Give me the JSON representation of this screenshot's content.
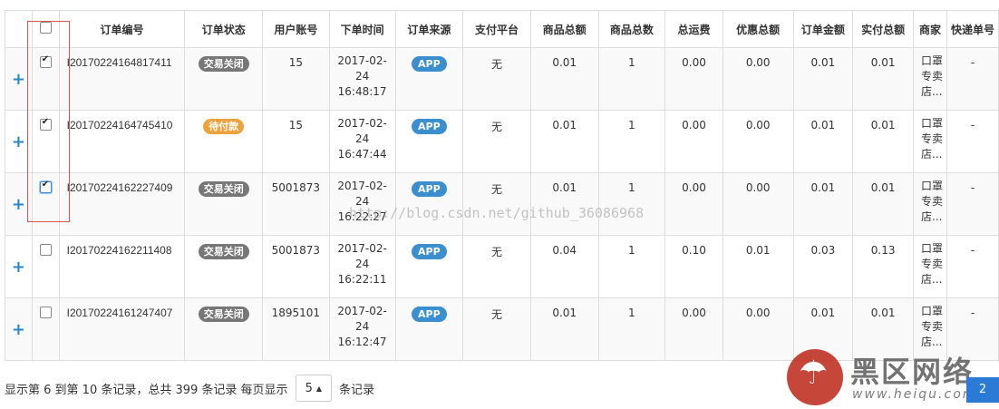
{
  "columns": [
    "",
    "",
    "订单编号",
    "订单状态",
    "用户账号",
    "下单时间",
    "订单来源",
    "支付平台",
    "商品总额",
    "商品总数",
    "总运费",
    "优惠总额",
    "订单金额",
    "实付总额",
    "商家",
    "快递单号"
  ],
  "rows": [
    {
      "expand": "+",
      "checked": true,
      "order_no": "I20170224164817411",
      "status": "交易关闭",
      "status_type": "closed",
      "user": "15",
      "time": [
        "2017-02-",
        "24",
        "16:48:17"
      ],
      "source": "APP",
      "pay": "无",
      "goods_total": "0.01",
      "goods_count": "1",
      "freight": "0.00",
      "discount": "0.00",
      "order_amount": "0.01",
      "paid": "0.01",
      "merchant": [
        "口罩",
        "专卖",
        "店..."
      ],
      "express": "-"
    },
    {
      "expand": "+",
      "checked": true,
      "order_no": "I20170224164745410",
      "status": "待付款",
      "status_type": "pending",
      "user": "15",
      "time": [
        "2017-02-",
        "24",
        "16:47:44"
      ],
      "source": "APP",
      "pay": "无",
      "goods_total": "0.01",
      "goods_count": "1",
      "freight": "0.00",
      "discount": "0.00",
      "order_amount": "0.01",
      "paid": "0.01",
      "merchant": [
        "口罩",
        "专卖",
        "店..."
      ],
      "express": "-"
    },
    {
      "expand": "+",
      "checked": true,
      "focus": true,
      "order_no": "I20170224162227409",
      "status": "交易关闭",
      "status_type": "closed",
      "user": "5001873",
      "time": [
        "2017-02-",
        "24",
        "16:22:27"
      ],
      "source": "APP",
      "pay": "无",
      "goods_total": "0.01",
      "goods_count": "1",
      "freight": "0.00",
      "discount": "0.00",
      "order_amount": "0.01",
      "paid": "0.01",
      "merchant": [
        "口罩",
        "专卖",
        "店..."
      ],
      "express": "-"
    },
    {
      "expand": "+",
      "checked": false,
      "order_no": "I20170224162211408",
      "status": "交易关闭",
      "status_type": "closed",
      "user": "5001873",
      "time": [
        "2017-02-",
        "24",
        "16:22:11"
      ],
      "source": "APP",
      "pay": "无",
      "goods_total": "0.04",
      "goods_count": "1",
      "freight": "0.10",
      "discount": "0.01",
      "order_amount": "0.03",
      "paid": "0.13",
      "merchant": [
        "口罩",
        "专卖",
        "店..."
      ],
      "express": "-"
    },
    {
      "expand": "+",
      "checked": false,
      "order_no": "I20170224161247407",
      "status": "交易关闭",
      "status_type": "closed",
      "user": "1895101",
      "time": [
        "2017-02-",
        "24",
        "16:12:47"
      ],
      "source": "APP",
      "pay": "无",
      "goods_total": "0.01",
      "goods_count": "1",
      "freight": "0.00",
      "discount": "0.00",
      "order_amount": "0.01",
      "paid": "0.01",
      "merchant": [
        "口罩",
        "专卖",
        "店..."
      ],
      "express": "-"
    }
  ],
  "watermark": "http://blog.csdn.net/github_36086968",
  "footer": {
    "summary": "显示第 6 到第 10 条记录，总共 399 条记录 每页显示",
    "page_size": "5",
    "suffix": "条记录"
  },
  "pager": {
    "current": "2"
  },
  "logo": {
    "brand": "黑区网络",
    "url": "www.heiqu.com"
  }
}
